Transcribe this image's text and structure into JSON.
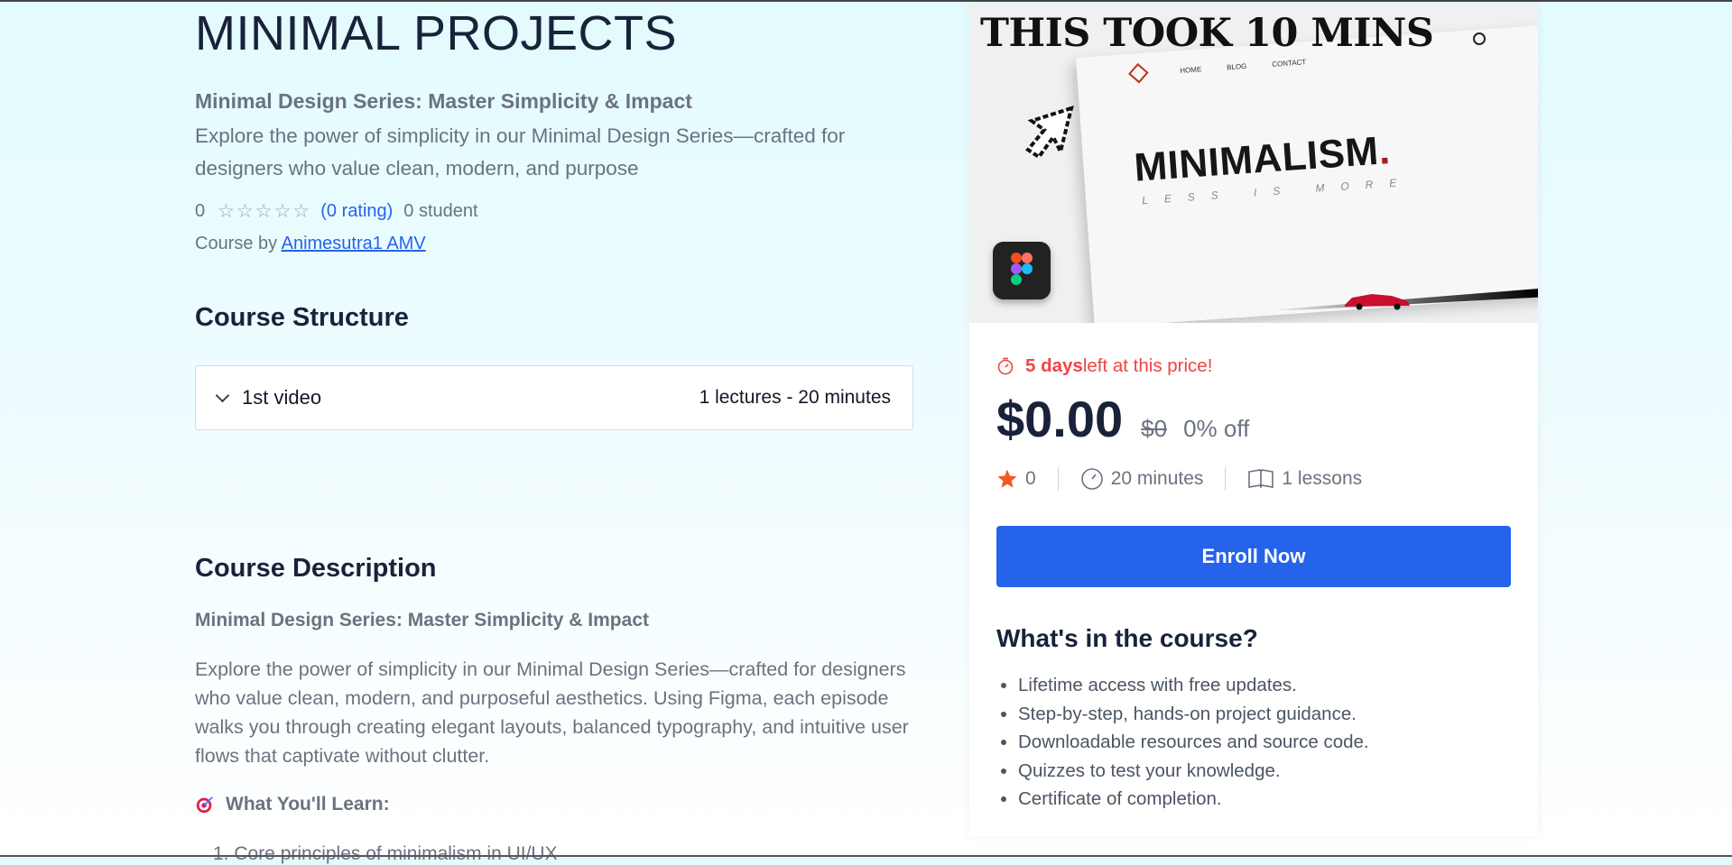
{
  "course": {
    "title": "MINIMAL PROJECTS",
    "subtitle": "Minimal Design Series: Master Simplicity & Impact",
    "lead": "Explore the power of simplicity in our Minimal Design Series—crafted for designers who value clean, modern, and purpose",
    "rating_value": "0",
    "stars": "☆☆☆☆☆",
    "rating_count": "(0 rating)",
    "students": "0 student",
    "byline_prefix": "Course by ",
    "author": "Animesutra1 AMV"
  },
  "structure": {
    "heading": "Course Structure",
    "sections": [
      {
        "title": "1st video",
        "summary": "1 lectures - 20 minutes"
      }
    ]
  },
  "description": {
    "heading": "Course Description",
    "subheading": "Minimal Design Series: Master Simplicity & Impact",
    "body": "Explore the power of simplicity in our Minimal Design Series—crafted for designers who value clean, modern, and purposeful aesthetics. Using Figma, each episode walks you through creating elegant layouts, balanced typography, and intuitive user flows that captivate without clutter.",
    "learn_heading": "What You'll Learn:",
    "learn_first_item_clipped": "1.  Core principles of minimalism in UI/UX"
  },
  "thumbnail": {
    "headline": "THIS TOOK 10 MINS",
    "nav": [
      "HOME",
      "BLOG",
      "CONTACT"
    ],
    "word": "MINIMALISM",
    "word_dot": ".",
    "tagline": "LESS IS MORE"
  },
  "card": {
    "timer_days": "5 days",
    "timer_rest": " left at this price!",
    "price": "$0.00",
    "old_price": "$0",
    "discount": "0% off",
    "stat_rating": "0",
    "stat_duration": "20 minutes",
    "stat_lessons": "1 lessons",
    "enroll_label": "Enroll Now",
    "whats_heading": "What's in the course?",
    "features": [
      "Lifetime access with free updates.",
      "Step-by-step, hands-on project guidance.",
      "Downloadable resources and source code.",
      "Quizzes to test your knowledge.",
      "Certificate of completion."
    ]
  },
  "colors": {
    "accent": "#2563eb",
    "timer_red": "#ef4444",
    "star_orange": "#f05a28",
    "heading": "#18233a",
    "muted": "#6b7280"
  },
  "icons": [
    "chevron-down-icon",
    "timer-icon",
    "star-icon",
    "clock-icon",
    "book-icon",
    "target-icon",
    "figma-icon",
    "cursor-icon"
  ]
}
